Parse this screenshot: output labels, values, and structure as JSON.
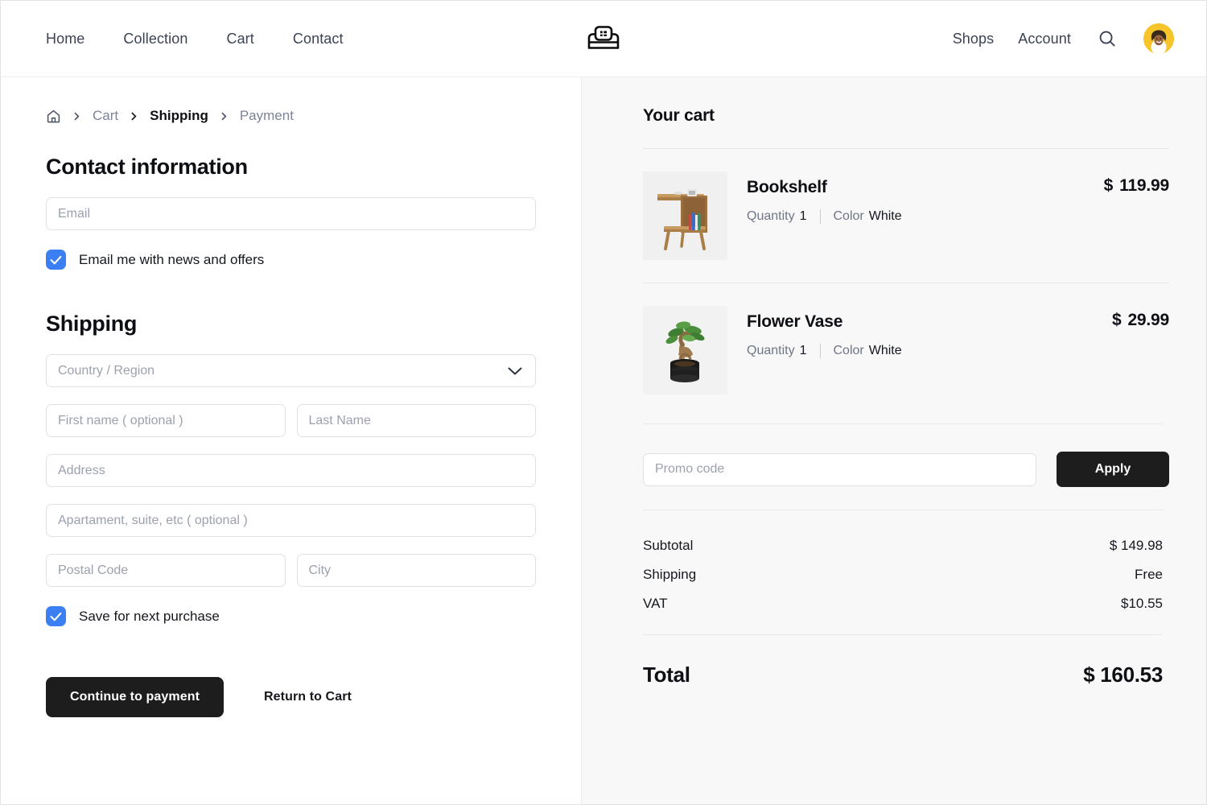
{
  "navbar": {
    "logo_icon": "sofa-logo-icon",
    "links": [
      {
        "label": "Home"
      },
      {
        "label": "Collection"
      },
      {
        "label": "Cart"
      },
      {
        "label": "Contact"
      }
    ],
    "right_links": [
      {
        "label": "Shops"
      },
      {
        "label": "Account"
      }
    ],
    "search_icon": "search-icon",
    "avatar_icon": "user-avatar",
    "avatar_bg": "#f7c52a"
  },
  "breadcrumb": {
    "home_icon": "home-icon",
    "separator": "chevron-right-icon",
    "items": [
      {
        "label": "Cart",
        "active": false
      },
      {
        "label": "Shipping",
        "active": true
      },
      {
        "label": "Payment",
        "active": false
      }
    ]
  },
  "contact": {
    "title": "Contact information",
    "email_placeholder": "Email",
    "email_value": "",
    "newsletter_label": "Email me with news and offers",
    "newsletter_checked": true
  },
  "shipping": {
    "title": "Shipping",
    "country_placeholder": "Country / Region",
    "country_value": "",
    "chevron_icon": "chevron-down-icon",
    "first_name_placeholder": "First name ( optional )",
    "first_name_value": "",
    "last_name_placeholder": "Last Name",
    "last_name_value": "",
    "address_placeholder": "Address",
    "address_value": "",
    "apartment_placeholder": "Apartament, suite, etc ( optional )",
    "apartment_value": "",
    "postal_placeholder": "Postal Code",
    "postal_value": "",
    "city_placeholder": "City",
    "city_value": "",
    "save_label": "Save for next purchase",
    "save_checked": true
  },
  "actions": {
    "primary_label": "Continue to payment",
    "secondary_label": "Return to Cart"
  },
  "cart": {
    "title": "Your cart",
    "meta_labels": {
      "quantity": "Quantity",
      "color": "Color"
    },
    "items": [
      {
        "name": "Bookshelf",
        "image_icon": "bookshelf-thumbnail",
        "quantity": "1",
        "color": "White",
        "currency": "$",
        "price": "119.99"
      },
      {
        "name": "Flower Vase",
        "image_icon": "flower-vase-thumbnail",
        "quantity": "1",
        "color": "White",
        "currency": "$",
        "price": "29.99"
      }
    ],
    "promo": {
      "placeholder": "Promo code",
      "value": "",
      "apply_label": "Apply"
    },
    "summary": [
      {
        "label": "Subtotal",
        "value": "$  149.98"
      },
      {
        "label": "Shipping",
        "value": "Free"
      },
      {
        "label": "VAT",
        "value": "$10.55"
      }
    ],
    "total": {
      "label": "Total",
      "value": "$ 160.53"
    }
  },
  "colors": {
    "accent_blue": "#3b7ff2",
    "dark_button": "#1d1d1d",
    "panel_bg": "#f8f8f9",
    "border": "#e0e1e4",
    "muted_text": "#7d8496"
  }
}
